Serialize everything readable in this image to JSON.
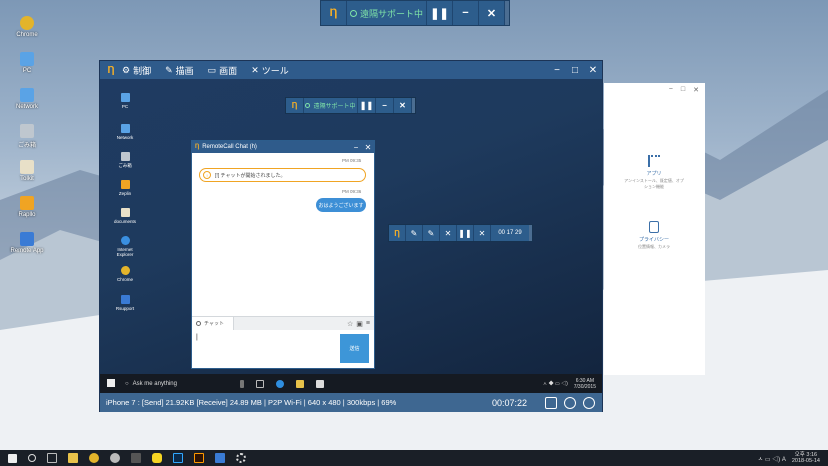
{
  "desktop": {
    "icons": [
      {
        "label": "Chrome",
        "color": "#e3b42b"
      },
      {
        "label": "PC",
        "color": "#5aa3e6"
      },
      {
        "label": "Network",
        "color": "#5aa3e6"
      },
      {
        "label": "ごみ箱",
        "color": "#bfc7cf"
      },
      {
        "label": "Tolkit",
        "color": "#e8e0c8"
      },
      {
        "label": "Rapllo",
        "color": "#f0a423"
      },
      {
        "label": "Remote App",
        "color": "#3a7bd5"
      }
    ]
  },
  "top_toolbar": {
    "logo": "Ƞ",
    "status_text": "遠隔サポート中",
    "pause_icon": "❚❚",
    "minimize_icon": "−",
    "close_icon": "✕"
  },
  "main_window": {
    "logo": "Ƞ",
    "menu": [
      {
        "icon": "⚙",
        "label": "制御"
      },
      {
        "icon": "✎",
        "label": "描画"
      },
      {
        "icon": "▭",
        "label": "画面"
      },
      {
        "icon": "✕",
        "label": "ツール"
      }
    ],
    "controls": {
      "minimize": "−",
      "maximize": "□",
      "close": "✕"
    },
    "sub_toolbar": {
      "logo": "Ƞ",
      "status_text": "遠隔サポート中",
      "pause_icon": "❚❚",
      "minimize_icon": "−",
      "close_icon": "✕"
    },
    "remote_icons": [
      {
        "label": "PC",
        "color": "#5aa3e6"
      },
      {
        "label": "Network",
        "color": "#5aa3e6"
      },
      {
        "label": "ごみ箱",
        "color": "#bfc7cf"
      },
      {
        "label": "Zeplin",
        "color": "#f0a423"
      },
      {
        "label": "documents",
        "color": "#e8e0c8"
      },
      {
        "label": "Internet Explorer",
        "color": "#3a8fe0"
      },
      {
        "label": "Chrome",
        "color": "#e3b42b"
      },
      {
        "label": "Rsupport",
        "color": "#3a7bd5"
      }
    ],
    "chat": {
      "logo": "Ƞ",
      "title": "RemoteCall Chat (h)",
      "minimize": "−",
      "close": "✕",
      "system_time": "PM 09:35",
      "system_message": "[!] チャットが開始されました。",
      "system_icon": "!",
      "bubble_time": "PM 09:36",
      "bubble_text": "おはようございます",
      "tab_label": "チャット",
      "tools": [
        "☆",
        "▣",
        "≡"
      ],
      "input_caret": "|",
      "send_label": "送信"
    },
    "float_bar": {
      "logo": "Ƞ",
      "buttons": [
        "✎",
        "✎",
        "✕",
        "❚❚",
        "✕"
      ],
      "timer": "00 17 29"
    },
    "remote_taskbar": {
      "search_placeholder": "Ask me anything",
      "search_icon": "○",
      "tray_text": "ㅅ ◆ ▭ ◁)",
      "time": "6:30 AM",
      "date": "7/30/2015"
    },
    "statusbar": {
      "info": "iPhone 7 : [Send] 21.92KB  [Receive] 24.89 MB | P2P Wi-Fi | 640 x 480 | 300kbps | 69%",
      "elapsed": "00:07:22"
    }
  },
  "side_panel": {
    "controls": {
      "minimize": "−",
      "maximize": "□",
      "close": "✕"
    },
    "items": [
      {
        "label": "アプリ",
        "sub": "アンインストール、既定値、オプション機能"
      },
      {
        "label": "プライバシー",
        "sub": "位置情報、カメラ"
      }
    ]
  },
  "taskbar": {
    "tray_text": "ㅅ ▭ ◁) A",
    "time": "오후 3:16",
    "date": "2018-05-14"
  }
}
